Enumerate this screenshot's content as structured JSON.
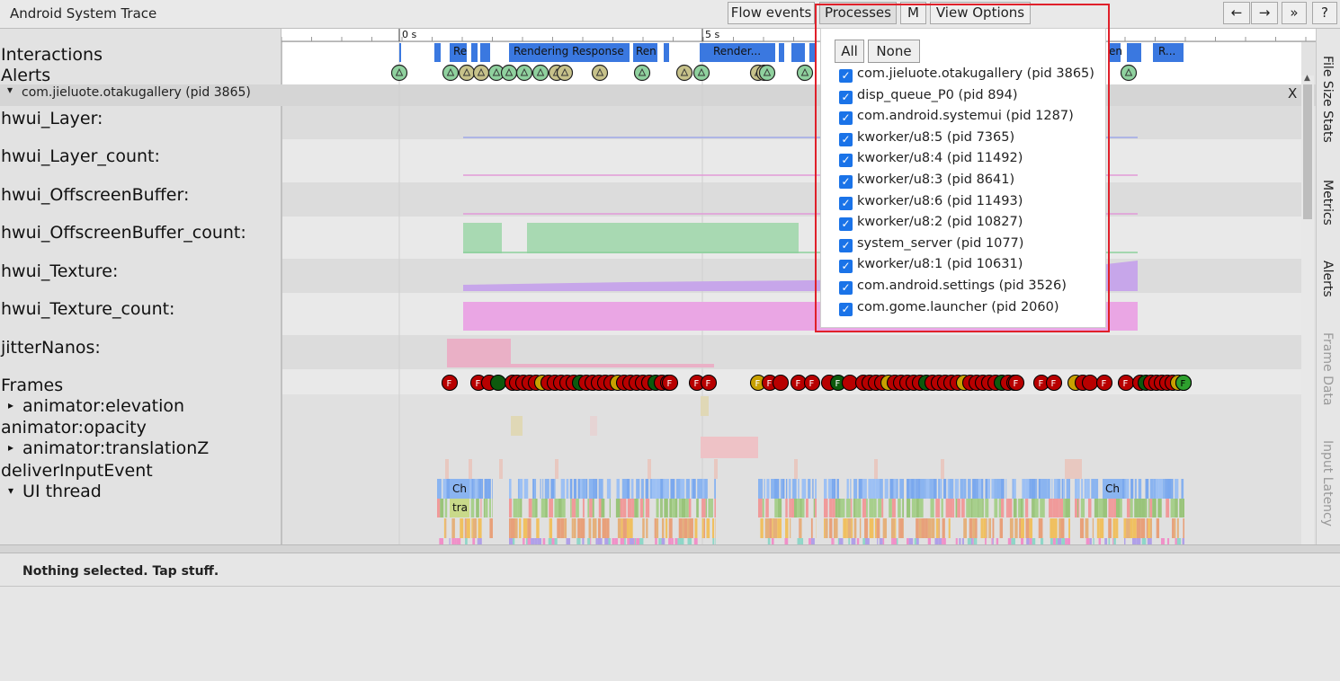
{
  "app": {
    "title": "Android System Trace"
  },
  "toolbar": {
    "flow_events": "Flow events",
    "processes": "Processes",
    "metadata": "M",
    "view_options": "View Options",
    "nav_left": "←",
    "nav_right": "→",
    "expand": "»",
    "help": "?"
  },
  "ruler": {
    "ticks": [
      "0 s",
      "5 s"
    ]
  },
  "tracks": {
    "interactions": "Interactions",
    "alerts": "Alerts",
    "process_header": "com.jieluote.otakugallery (pid 3865)",
    "process_close": "X",
    "counters": [
      "hwui_Layer:",
      "hwui_Layer_count:",
      "hwui_OffscreenBuffer:",
      "hwui_OffscreenBuffer_count:",
      "hwui_Texture:",
      "hwui_Texture_count:",
      "jitterNanos:"
    ],
    "frames": "Frames",
    "animator_elevation": "animator:elevation",
    "animator_opacity": "animator:opacity",
    "animator_translationz": "animator:translationZ",
    "deliver_input_event": "deliverInputEvent",
    "ui_thread": "UI thread",
    "interaction_labels": [
      "Re",
      "Rendering Response",
      "Ren",
      "Render...",
      "en",
      "R..."
    ],
    "frame_marker": "F",
    "ui_slice_labels": [
      "Ch",
      "tra",
      "Ch"
    ]
  },
  "side_tabs": [
    "File Size Stats",
    "Metrics",
    "Alerts",
    "Frame Data",
    "Input Latency"
  ],
  "analysis": {
    "status": "Nothing selected. Tap stuff."
  },
  "process_dropdown": {
    "all_button": "All",
    "none_button": "None",
    "processes": [
      {
        "name": "com.jieluote.otakugallery (pid 3865)",
        "checked": true
      },
      {
        "name": "disp_queue_P0 (pid 894)",
        "checked": true
      },
      {
        "name": "com.android.systemui (pid 1287)",
        "checked": true
      },
      {
        "name": "kworker/u8:5 (pid 7365)",
        "checked": true
      },
      {
        "name": "kworker/u8:4 (pid 11492)",
        "checked": true
      },
      {
        "name": "kworker/u8:3 (pid 8641)",
        "checked": true
      },
      {
        "name": "kworker/u8:6 (pid 11493)",
        "checked": true
      },
      {
        "name": "kworker/u8:2 (pid 10827)",
        "checked": true
      },
      {
        "name": "system_server (pid 1077)",
        "checked": true
      },
      {
        "name": "kworker/u8:1 (pid 10631)",
        "checked": true
      },
      {
        "name": "com.android.settings (pid 3526)",
        "checked": true
      },
      {
        "name": "com.gome.launcher (pid 2060)",
        "checked": true
      }
    ]
  },
  "colors": {
    "interaction_slice": "#3a78e0",
    "alert_green": "#8fd19e",
    "alert_tan": "#c7c28a",
    "frame_red": "#b80000",
    "frame_green": "#2ea02e",
    "frame_gold": "#c8a000",
    "check_blue": "#1a73e8",
    "highlight_red": "#e0202a"
  }
}
